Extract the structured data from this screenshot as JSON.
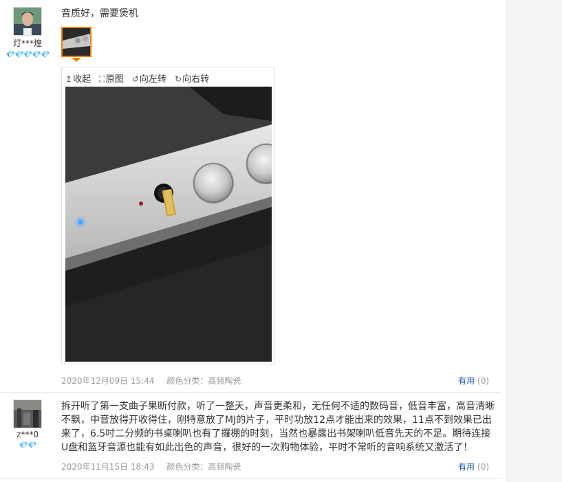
{
  "reviews": [
    {
      "user": {
        "name": "灯***煌",
        "badge_icons": "💎💎💎💎💎"
      },
      "text": "音质好，需要煲机",
      "toolbar": {
        "collapse": "收起",
        "original": "原图",
        "rotate_left": "向左转",
        "rotate_right": "向右转"
      },
      "date": "2020年12月09日 15:44",
      "color_label": "颜色分类：高频陶瓷",
      "useful_label": "有用",
      "useful_count": "(0)"
    },
    {
      "user": {
        "name": "z***0",
        "badge_icons": "💎💎"
      },
      "text": "拆开听了第一支曲子果断付款，听了一整天，声音更柔和，无任何不适的数码音，低音丰富，高音清晰不飘，中音放得开收得住，刚特意放了MJ的片子，平时功放12点才能出来的效果，11点不到效果已出来了，6.5吋二分频的书桌喇叭也有了攞棚的时刻，当然也暴露出书架喇叭低音先天的不足。期待连接U盘和蓝牙音源也能有如此出色的声音，很好的一次购物体验，平时不常听的音响系统又激活了！",
      "date": "2020年11月15日 18:43",
      "color_label": "颜色分类：高频陶瓷",
      "useful_label": "有用",
      "useful_count": "(0)"
    }
  ],
  "icons": {
    "collapse": "up-arrow-icon",
    "original": "expand-icon",
    "rotate_left": "rotate-left-icon",
    "rotate_right": "rotate-right-icon"
  }
}
